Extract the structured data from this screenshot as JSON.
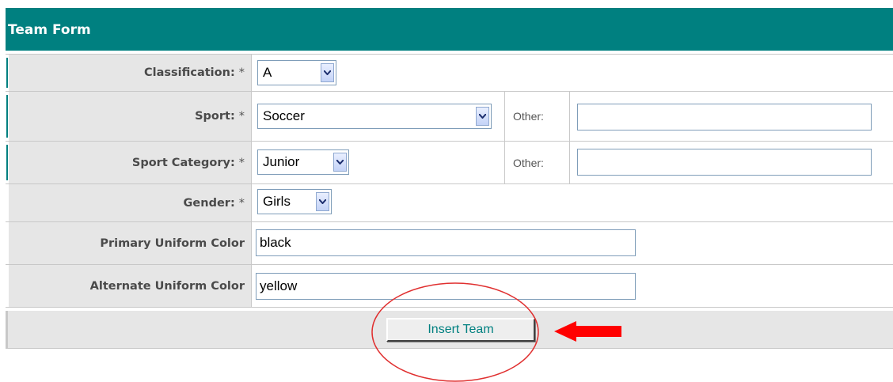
{
  "form": {
    "title": "Team Form",
    "classification": {
      "label": "Classification:",
      "required": "*",
      "value": "A"
    },
    "sport": {
      "label": "Sport:",
      "required": "*",
      "value": "Soccer",
      "other_label": "Other:",
      "other_value": ""
    },
    "sport_category": {
      "label": "Sport Category:",
      "required": "*",
      "value": "Junior",
      "other_label": "Other:",
      "other_value": ""
    },
    "gender": {
      "label": "Gender:",
      "required": "*",
      "value": "Girls"
    },
    "primary_color": {
      "label": "Primary Uniform Color",
      "value": "black"
    },
    "alternate_color": {
      "label": "Alternate Uniform Color",
      "value": "yellow"
    },
    "submit_label": "Insert Team"
  },
  "annotations": {
    "circle_color": "#e03030",
    "arrow_color": "#ff0000"
  },
  "colors": {
    "header": "#008080",
    "label_bg": "#e6e6e6",
    "button_text": "#008080"
  }
}
